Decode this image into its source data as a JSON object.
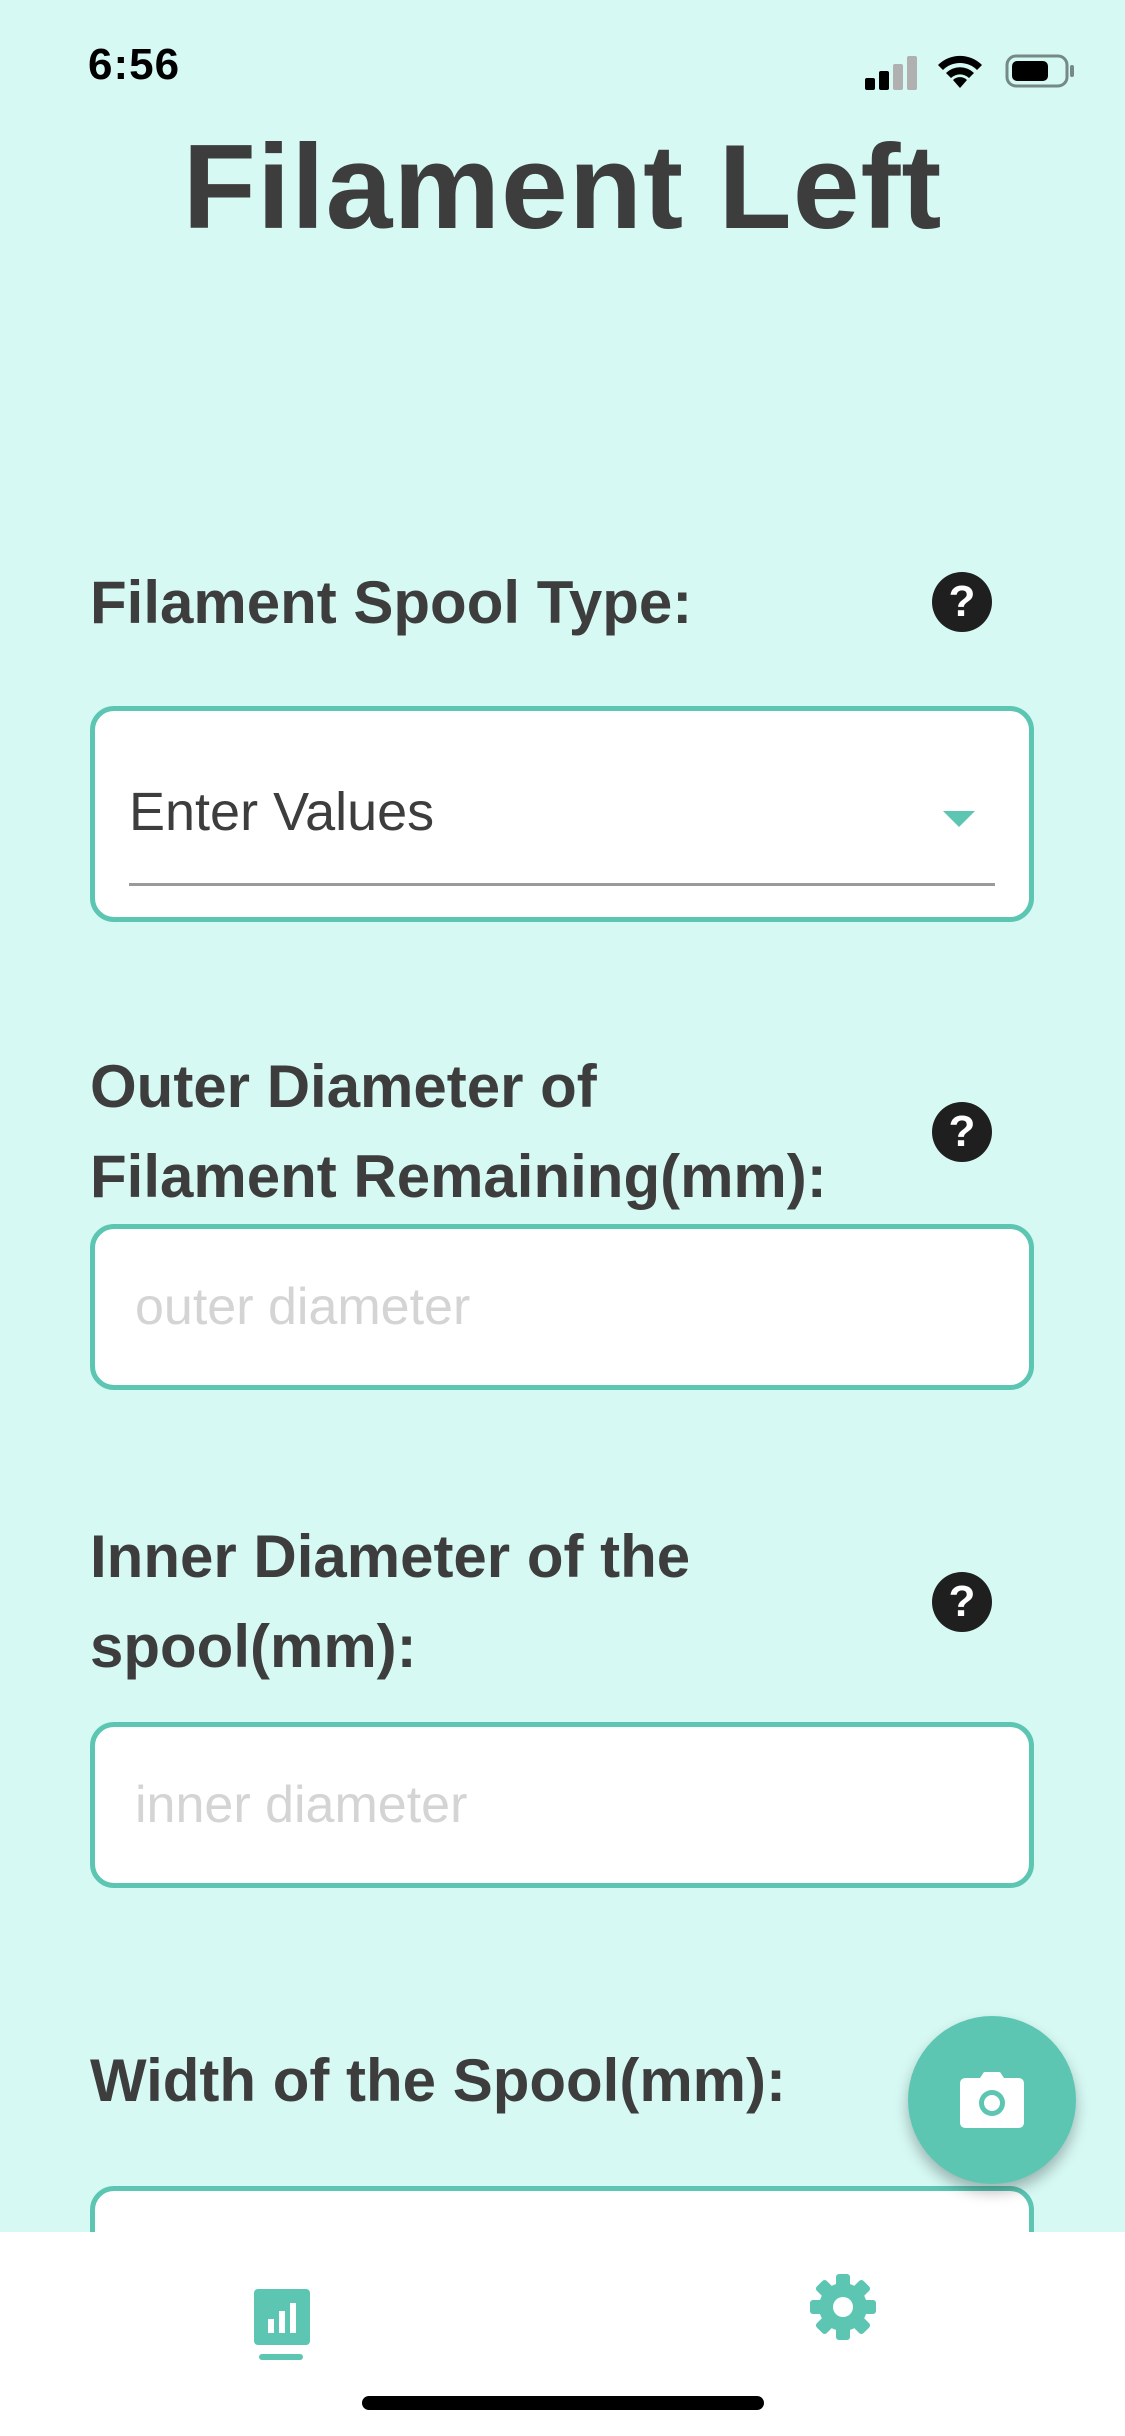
{
  "status_bar": {
    "time": "6:56",
    "icons": [
      "signal-icon",
      "wifi-icon",
      "battery-icon"
    ]
  },
  "header": {
    "title": "Filament Left"
  },
  "form": {
    "spool_type": {
      "label": "Filament Spool Type:",
      "value": "Enter Values",
      "help": "?"
    },
    "outer_diameter": {
      "label_line1": "Outer Diameter of",
      "label_line2": "Filament Remaining(mm):",
      "placeholder": "outer diameter",
      "value": "",
      "help": "?"
    },
    "inner_diameter": {
      "label_line1": "Inner Diameter of the",
      "label_line2": "spool(mm):",
      "placeholder": "inner diameter",
      "value": "",
      "help": "?"
    },
    "spool_width": {
      "label": "Width of the Spool(mm):"
    }
  },
  "fab": {
    "icon": "camera-icon"
  },
  "tab_bar": {
    "tabs": [
      {
        "icon": "bar-chart-icon",
        "active": true
      },
      {
        "icon": "gear-icon",
        "active": false
      }
    ]
  },
  "colors": {
    "background": "#d6f9f4",
    "accent": "#5cc6b3",
    "text": "#3d3d3d"
  }
}
